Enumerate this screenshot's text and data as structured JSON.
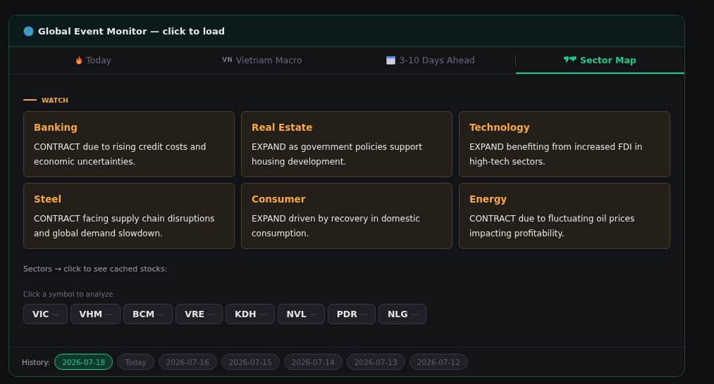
{
  "header": {
    "title": "Global Event Monitor — click to load"
  },
  "tabs": [
    {
      "kind": "fire",
      "label": "Today",
      "selected": false
    },
    {
      "kind": "flag",
      "flag_text": "VN",
      "label": "Vietnam Macro",
      "selected": false
    },
    {
      "kind": "calendar",
      "label": "3-10 Days Ahead",
      "selected": false
    },
    {
      "kind": "map",
      "label": "Sector Map",
      "selected": true
    }
  ],
  "section_label": "WATCH",
  "sectors": [
    {
      "name": "Banking",
      "outlook": "CONTRACT due to rising credit costs and economic uncertainties."
    },
    {
      "name": "Real Estate",
      "outlook": "EXPAND as government policies support housing development."
    },
    {
      "name": "Technology",
      "outlook": "EXPAND benefiting from increased FDI in high-tech sectors."
    },
    {
      "name": "Steel",
      "outlook": "CONTRACT facing supply chain disruptions and global demand slowdown."
    },
    {
      "name": "Consumer",
      "outlook": "EXPAND driven by recovery in domestic consumption."
    },
    {
      "name": "Energy",
      "outlook": "CONTRACT due to fluctuating oil prices impacting profitability."
    }
  ],
  "sectors_hint": "Sectors → click to see cached stocks:",
  "symbols_hint": "Click a symbol to analyze",
  "symbols": [
    {
      "ticker": "VIC",
      "change": "—"
    },
    {
      "ticker": "VHM",
      "change": "—"
    },
    {
      "ticker": "BCM",
      "change": "—"
    },
    {
      "ticker": "VRE",
      "change": "—"
    },
    {
      "ticker": "KDH",
      "change": "—"
    },
    {
      "ticker": "NVL",
      "change": "—"
    },
    {
      "ticker": "PDR",
      "change": "—"
    },
    {
      "ticker": "NLG",
      "change": "—"
    }
  ],
  "history": {
    "label": "History:",
    "dates": [
      {
        "label": "2026-07-18",
        "selected": true
      },
      {
        "label": "Today",
        "selected": false
      },
      {
        "label": "2026-07-16",
        "selected": false
      },
      {
        "label": "2026-07-15",
        "selected": false
      },
      {
        "label": "2026-07-14",
        "selected": false
      },
      {
        "label": "2026-07-13",
        "selected": false
      },
      {
        "label": "2026-07-12",
        "selected": false
      }
    ]
  }
}
